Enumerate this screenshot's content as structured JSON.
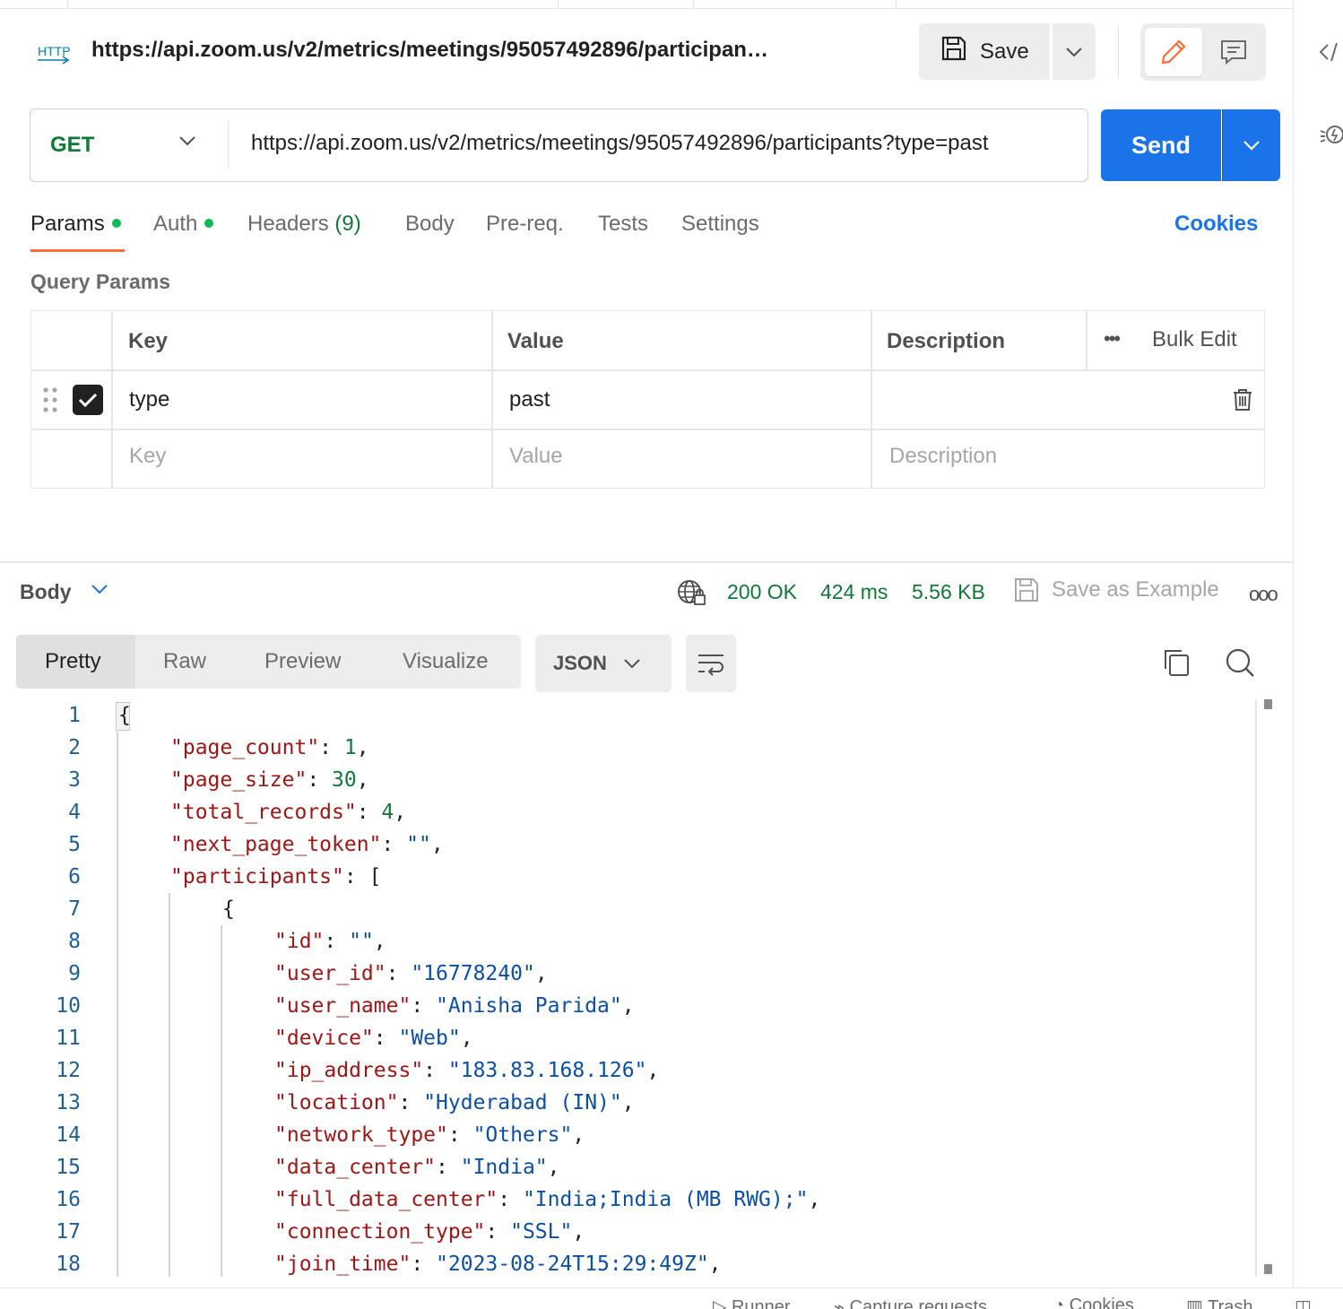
{
  "header": {
    "request_title": "https://api.zoom.us/v2/metrics/meetings/95057492896/participan…",
    "save_label": "Save",
    "http_badge": "HTTP"
  },
  "request": {
    "method": "GET",
    "url": "https://api.zoom.us/v2/metrics/meetings/95057492896/participants?type=past",
    "send_label": "Send"
  },
  "tabs": {
    "params": "Params",
    "auth": "Auth",
    "headers": "Headers",
    "headers_count": "(9)",
    "body": "Body",
    "prereq": "Pre-req.",
    "tests": "Tests",
    "settings": "Settings",
    "cookies": "Cookies"
  },
  "query_params": {
    "title": "Query Params",
    "columns": {
      "key": "Key",
      "value": "Value",
      "description": "Description",
      "bulk_edit": "Bulk Edit"
    },
    "rows": [
      {
        "key": "type",
        "value": "past",
        "description": "",
        "enabled": true
      }
    ],
    "placeholders": {
      "key": "Key",
      "value": "Value",
      "description": "Description"
    }
  },
  "response": {
    "body_label": "Body",
    "status": "200 OK",
    "time": "424 ms",
    "size": "5.56 KB",
    "save_example": "Save as Example",
    "view_tabs": [
      "Pretty",
      "Raw",
      "Preview",
      "Visualize"
    ],
    "format": "JSON",
    "lines": [
      {
        "n": "1",
        "indent": 0,
        "parts": [
          [
            "p",
            "{"
          ]
        ]
      },
      {
        "n": "2",
        "indent": 1,
        "parts": [
          [
            "k",
            "\"page_count\""
          ],
          [
            "p",
            ": "
          ],
          [
            "n",
            "1"
          ],
          [
            "p",
            ","
          ]
        ]
      },
      {
        "n": "3",
        "indent": 1,
        "parts": [
          [
            "k",
            "\"page_size\""
          ],
          [
            "p",
            ": "
          ],
          [
            "n",
            "30"
          ],
          [
            "p",
            ","
          ]
        ]
      },
      {
        "n": "4",
        "indent": 1,
        "parts": [
          [
            "k",
            "\"total_records\""
          ],
          [
            "p",
            ": "
          ],
          [
            "n",
            "4"
          ],
          [
            "p",
            ","
          ]
        ]
      },
      {
        "n": "5",
        "indent": 1,
        "parts": [
          [
            "k",
            "\"next_page_token\""
          ],
          [
            "p",
            ": "
          ],
          [
            "s",
            "\"\""
          ],
          [
            "p",
            ","
          ]
        ]
      },
      {
        "n": "6",
        "indent": 1,
        "parts": [
          [
            "k",
            "\"participants\""
          ],
          [
            "p",
            ": ["
          ]
        ]
      },
      {
        "n": "7",
        "indent": 2,
        "parts": [
          [
            "p",
            "{"
          ]
        ]
      },
      {
        "n": "8",
        "indent": 3,
        "parts": [
          [
            "k",
            "\"id\""
          ],
          [
            "p",
            ": "
          ],
          [
            "s",
            "\"\""
          ],
          [
            "p",
            ","
          ]
        ]
      },
      {
        "n": "9",
        "indent": 3,
        "parts": [
          [
            "k",
            "\"user_id\""
          ],
          [
            "p",
            ": "
          ],
          [
            "s",
            "\"16778240\""
          ],
          [
            "p",
            ","
          ]
        ]
      },
      {
        "n": "10",
        "indent": 3,
        "parts": [
          [
            "k",
            "\"user_name\""
          ],
          [
            "p",
            ": "
          ],
          [
            "s",
            "\"Anisha Parida\""
          ],
          [
            "p",
            ","
          ]
        ]
      },
      {
        "n": "11",
        "indent": 3,
        "parts": [
          [
            "k",
            "\"device\""
          ],
          [
            "p",
            ": "
          ],
          [
            "s",
            "\"Web\""
          ],
          [
            "p",
            ","
          ]
        ]
      },
      {
        "n": "12",
        "indent": 3,
        "parts": [
          [
            "k",
            "\"ip_address\""
          ],
          [
            "p",
            ": "
          ],
          [
            "s",
            "\"183.83.168.126\""
          ],
          [
            "p",
            ","
          ]
        ]
      },
      {
        "n": "13",
        "indent": 3,
        "parts": [
          [
            "k",
            "\"location\""
          ],
          [
            "p",
            ": "
          ],
          [
            "s",
            "\"Hyderabad (IN)\""
          ],
          [
            "p",
            ","
          ]
        ]
      },
      {
        "n": "14",
        "indent": 3,
        "parts": [
          [
            "k",
            "\"network_type\""
          ],
          [
            "p",
            ": "
          ],
          [
            "s",
            "\"Others\""
          ],
          [
            "p",
            ","
          ]
        ]
      },
      {
        "n": "15",
        "indent": 3,
        "parts": [
          [
            "k",
            "\"data_center\""
          ],
          [
            "p",
            ": "
          ],
          [
            "s",
            "\"India\""
          ],
          [
            "p",
            ","
          ]
        ]
      },
      {
        "n": "16",
        "indent": 3,
        "parts": [
          [
            "k",
            "\"full_data_center\""
          ],
          [
            "p",
            ": "
          ],
          [
            "s",
            "\"India;India (MB RWG);\""
          ],
          [
            "p",
            ","
          ]
        ]
      },
      {
        "n": "17",
        "indent": 3,
        "parts": [
          [
            "k",
            "\"connection_type\""
          ],
          [
            "p",
            ": "
          ],
          [
            "s",
            "\"SSL\""
          ],
          [
            "p",
            ","
          ]
        ]
      },
      {
        "n": "18",
        "indent": 3,
        "parts": [
          [
            "k",
            "\"join_time\""
          ],
          [
            "p",
            ": "
          ],
          [
            "s",
            "\"2023-08-24T15:29:49Z\""
          ],
          [
            "p",
            ","
          ]
        ]
      }
    ]
  },
  "statusbar": {
    "items": [
      "Runner",
      "Capture requests",
      "Cookies",
      "Trash"
    ]
  },
  "colors": {
    "accent_blue": "#1a73e8",
    "active_tab": "#ff6c37",
    "success_green": "#0f7a36",
    "json_key": "#a31515",
    "json_string": "#0a4fa8"
  }
}
